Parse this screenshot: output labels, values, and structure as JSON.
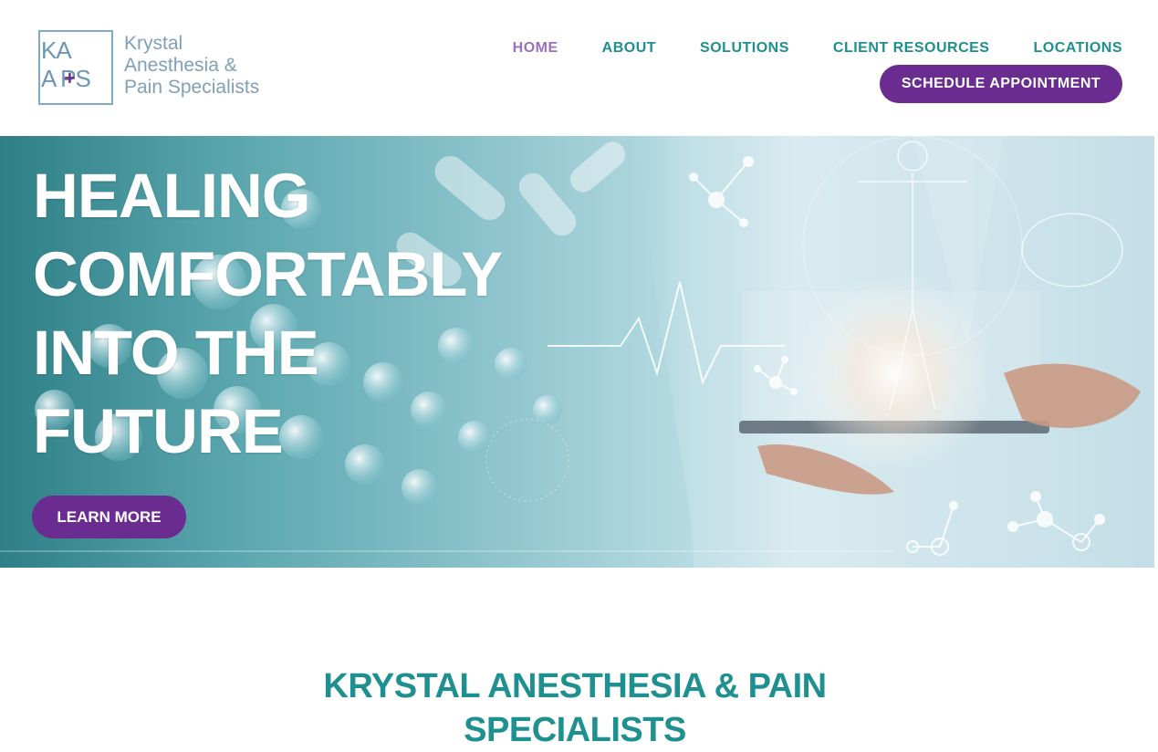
{
  "logo": {
    "monogram_top": "KA",
    "monogram_bottom": "A PS",
    "plus": "+",
    "name_line1": "Krystal",
    "name_line2": "Anesthesia &",
    "name_line3": "Pain Specialists"
  },
  "nav": {
    "items": [
      {
        "label": "HOME",
        "active": true
      },
      {
        "label": "ABOUT"
      },
      {
        "label": "SOLUTIONS"
      },
      {
        "label": "CLIENT RESOURCES"
      },
      {
        "label": "LOCATIONS"
      }
    ],
    "cta": "SCHEDULE APPOINTMENT"
  },
  "hero": {
    "title_lines": [
      "HEALING",
      "COMFORTABLY",
      "INTO THE",
      "FUTURE"
    ],
    "button": "LEARN MORE"
  },
  "intro": {
    "title_line1": "KRYSTAL ANESTHESIA & PAIN",
    "title_line2": "SPECIALISTS"
  },
  "colors": {
    "brand_purple": "#6b2c91",
    "brand_teal": "#1e8f8f",
    "nav_active": "#9b6fc0"
  }
}
